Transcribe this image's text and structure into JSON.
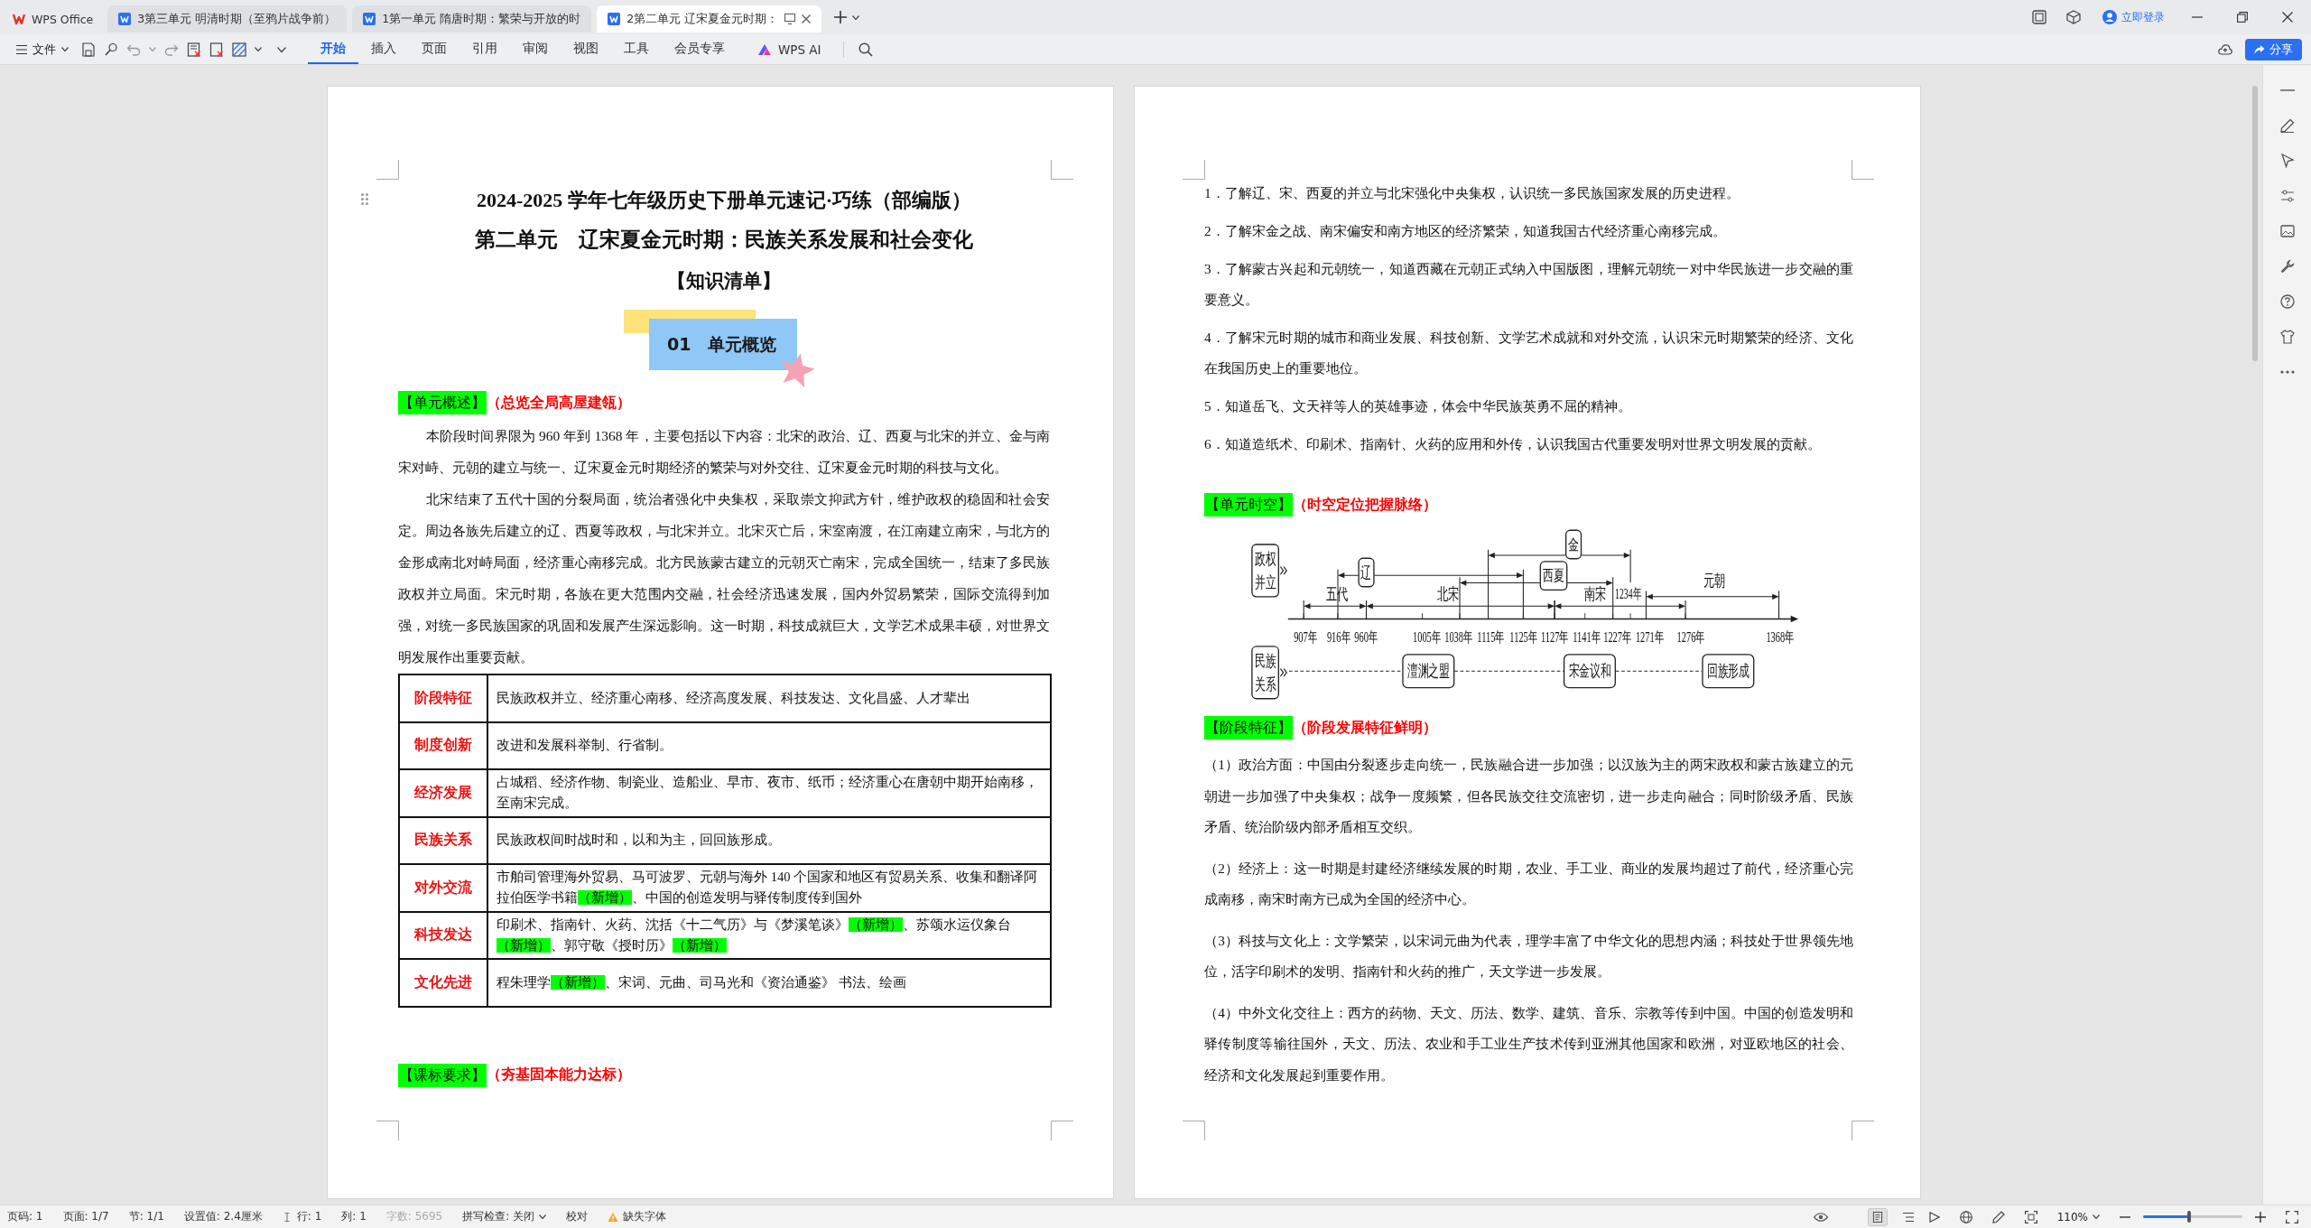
{
  "tabs": [
    {
      "kind": "home",
      "label": "WPS Office",
      "selected": false
    },
    {
      "kind": "doc",
      "label": "3第三单元 明清时期（至鸦片战争前）",
      "selected": false
    },
    {
      "kind": "doc",
      "label": "1第一单元 隋唐时期：繁荣与开放的时",
      "selected": false
    },
    {
      "kind": "doc",
      "label": "2第二单元 辽宋夏金元时期：",
      "selected": true
    }
  ],
  "account": {
    "login": "立即登录"
  },
  "toolbar": {
    "file_menu": "文件",
    "ribbon_tabs": [
      {
        "label": "开始",
        "selected": true
      },
      {
        "label": "插入",
        "selected": false
      },
      {
        "label": "页面",
        "selected": false
      },
      {
        "label": "引用",
        "selected": false
      },
      {
        "label": "审阅",
        "selected": false
      },
      {
        "label": "视图",
        "selected": false
      },
      {
        "label": "工具",
        "selected": false
      },
      {
        "label": "会员专享",
        "selected": false
      }
    ],
    "ai_button": "WPS AI",
    "share_button": "分享"
  },
  "left_page": {
    "title": "2024-2025 学年七年级历史下册单元速记·巧练（部编版）",
    "subtitle": "第二单元　辽宋夏金元时期：民族关系发展和社会变化",
    "heading": "【知识清单】",
    "badge": "01　单元概览",
    "overview": {
      "tag": "【单元概述】",
      "note": "（总览全局高屋建瓴）",
      "paragraphs": [
        "本阶段时间界限为 960 年到 1368 年，主要包括以下内容：北宋的政治、辽、西夏与北宋的并立、金与南宋对峙、元朝的建立与统一、辽宋夏金元时期经济的繁荣与对外交往、辽宋夏金元时期的科技与文化。",
        "北宋结束了五代十国的分裂局面，统治者强化中央集权，采取崇文抑武方针，维护政权的稳固和社会安定。周边各族先后建立的辽、西夏等政权，与北宋并立。北宋灭亡后，宋室南渡，在江南建立南宋，与北方的金形成南北对峙局面，经济重心南移完成。北方民族蒙古建立的元朝灭亡南宋，完成全国统一，结束了多民族政权并立局面。宋元时期，各族在更大范围内交融，社会经济迅速发展，国内外贸易繁荣，国际交流得到加强，对统一多民族国家的巩固和发展产生深远影响。这一时期，科技成就巨大，文学艺术成果丰硕，对世界文明发展作出重要贡献。"
      ]
    },
    "table": {
      "rows": [
        {
          "label": "阶段特征",
          "segments": [
            {
              "text": "民族政权并立、经济重心南移、经济高度发展、科技发达、文化昌盛、人才辈出",
              "highlight": false
            }
          ]
        },
        {
          "label": "制度创新",
          "segments": [
            {
              "text": "改进和发展科举制、行省制。",
              "highlight": false
            }
          ]
        },
        {
          "label": "经济发展",
          "segments": [
            {
              "text": "占城稻、经济作物、制瓷业、造船业、早市、夜市、纸币；经济重心在唐朝中期开始南移，至南宋完成。",
              "highlight": false
            }
          ]
        },
        {
          "label": "民族关系",
          "segments": [
            {
              "text": "民族政权间时战时和，以和为主，回回族形成。",
              "highlight": false
            }
          ]
        },
        {
          "label": "对外交流",
          "segments": [
            {
              "text": "市舶司管理海外贸易、马可波罗、元朝与海外 140 个国家和地区有贸易关系、收集和翻译阿拉伯医学书籍",
              "highlight": false
            },
            {
              "text": "（新增）",
              "highlight": true
            },
            {
              "text": "、中国的创造发明与驿传制度传到国外",
              "highlight": false
            }
          ]
        },
        {
          "label": "科技发达",
          "segments": [
            {
              "text": "印刷术、指南针、火药、沈括《十二气历》与《梦溪笔谈》",
              "highlight": false
            },
            {
              "text": "（新增）",
              "highlight": true
            },
            {
              "text": "、苏颂水运仪象台",
              "highlight": false
            },
            {
              "text": "（新增）",
              "highlight": true
            },
            {
              "text": "、郭守敬《授时历》",
              "highlight": false
            },
            {
              "text": "（新增）",
              "highlight": true
            }
          ]
        },
        {
          "label": "文化先进",
          "segments": [
            {
              "text": "程朱理学",
              "highlight": false
            },
            {
              "text": "（新增）",
              "highlight": true
            },
            {
              "text": "、宋词、元曲、司马光和《资治通鉴》 书法、绘画",
              "highlight": false
            }
          ]
        }
      ]
    },
    "next_section": {
      "tag": "【课标要求】",
      "note": "（夯基固本能力达标）"
    }
  },
  "right_page": {
    "requirements": [
      "1．了解辽、宋、西夏的并立与北宋强化中央集权，认识统一多民族国家发展的历史进程。",
      "2．了解宋金之战、南宋偏安和南方地区的经济繁荣，知道我国古代经济重心南移完成。",
      "3．了解蒙古兴起和元朝统一，知道西藏在元朝正式纳入中国版图，理解元朝统一对中华民族进一步交融的重要意义。",
      "4．了解宋元时期的城市和商业发展、科技创新、文学艺术成就和对外交流，认识宋元时期繁荣的经济、文化在我国历史上的重要地位。",
      "5．知道岳飞、文天祥等人的英雄事迹，体会中华民族英勇不屈的精神。",
      "6．知道造纸术、印刷术、指南针、火药的应用和外传，认识我国古代重要发明对世界文明发展的贡献。"
    ],
    "timeline_section": {
      "tag": "【单元时空】",
      "note": "（时空定位把握脉络）"
    },
    "timeline": {
      "rows": [
        {
          "lines": [
            "政权",
            "并立"
          ]
        },
        {
          "lines": [
            "民族",
            "关系"
          ]
        }
      ],
      "years": [
        "907年",
        "916年",
        "960年",
        "1005年",
        "1038年",
        "1115年",
        "1125年",
        "1127年",
        "1141年",
        "1227年",
        "1271年",
        "1276年",
        "1368年"
      ],
      "periods": [
        {
          "label": "五代",
          "boxed": false
        },
        {
          "label": "辽",
          "boxed": true
        },
        {
          "label": "北宋",
          "boxed": false
        },
        {
          "label": "西夏",
          "boxed": true
        },
        {
          "label": "金",
          "boxed": true,
          "end_label": "1234年"
        },
        {
          "label": "南宋",
          "boxed": false
        },
        {
          "label": "元朝",
          "boxed": false
        }
      ],
      "events": [
        "澶渊之盟",
        "宋金议和",
        "回族形成"
      ]
    },
    "features_section": {
      "tag": "【阶段特征】",
      "note": "（阶段发展特征鲜明）"
    },
    "features": [
      "（1）政治方面：中国由分裂逐步走向统一，民族融合进一步加强；以汉族为主的两宋政权和蒙古族建立的元朝进一步加强了中央集权；战争一度频繁，但各民族交往交流密切，进一步走向融合；同时阶级矛盾、民族矛盾、统治阶级内部矛盾相互交织。",
      "（2）经济上：这一时期是封建经济继续发展的时期，农业、手工业、商业的发展均超过了前代，经济重心完成南移，南宋时南方已成为全国的经济中心。",
      "（3）科技与文化上：文学繁荣，以宋词元曲为代表，理学丰富了中华文化的思想内涵；科技处于世界领先地位，活字印刷术的发明、指南针和火药的推广，天文学进一步发展。",
      "（4）中外文化交往上：西方的药物、天文、历法、数学、建筑、音乐、宗教等传到中国。中国的创造发明和驿传制度等输往国外，天文、历法、农业和手工业生产技术传到亚洲其他国家和欧洲，对亚欧地区的社会、经济和文化发展起到重要作用。"
    ]
  },
  "status_bar": {
    "items": [
      {
        "kind": "text",
        "text": "页码: 1",
        "disabled": false
      },
      {
        "kind": "text",
        "text": "页面: 1/7",
        "disabled": false
      },
      {
        "kind": "text",
        "text": "节: 1/1",
        "disabled": false
      },
      {
        "kind": "text",
        "text": "设置值: 2.4厘米",
        "disabled": false
      },
      {
        "kind": "position",
        "text": "行: 1",
        "disabled": false
      },
      {
        "kind": "text",
        "text": "列: 1",
        "disabled": false
      },
      {
        "kind": "text",
        "text": "字数: 5695",
        "disabled": true
      },
      {
        "kind": "dropdown",
        "text": "拼写检查: 关闭",
        "disabled": false
      },
      {
        "kind": "button",
        "text": "校对",
        "disabled": false
      },
      {
        "kind": "warning",
        "text": "缺失字体",
        "disabled": false
      }
    ],
    "view_modes": [
      {
        "kind": "page",
        "selected": true
      },
      {
        "kind": "outline",
        "selected": false
      }
    ],
    "zoom": {
      "label": "110%",
      "level": 0.46
    }
  }
}
